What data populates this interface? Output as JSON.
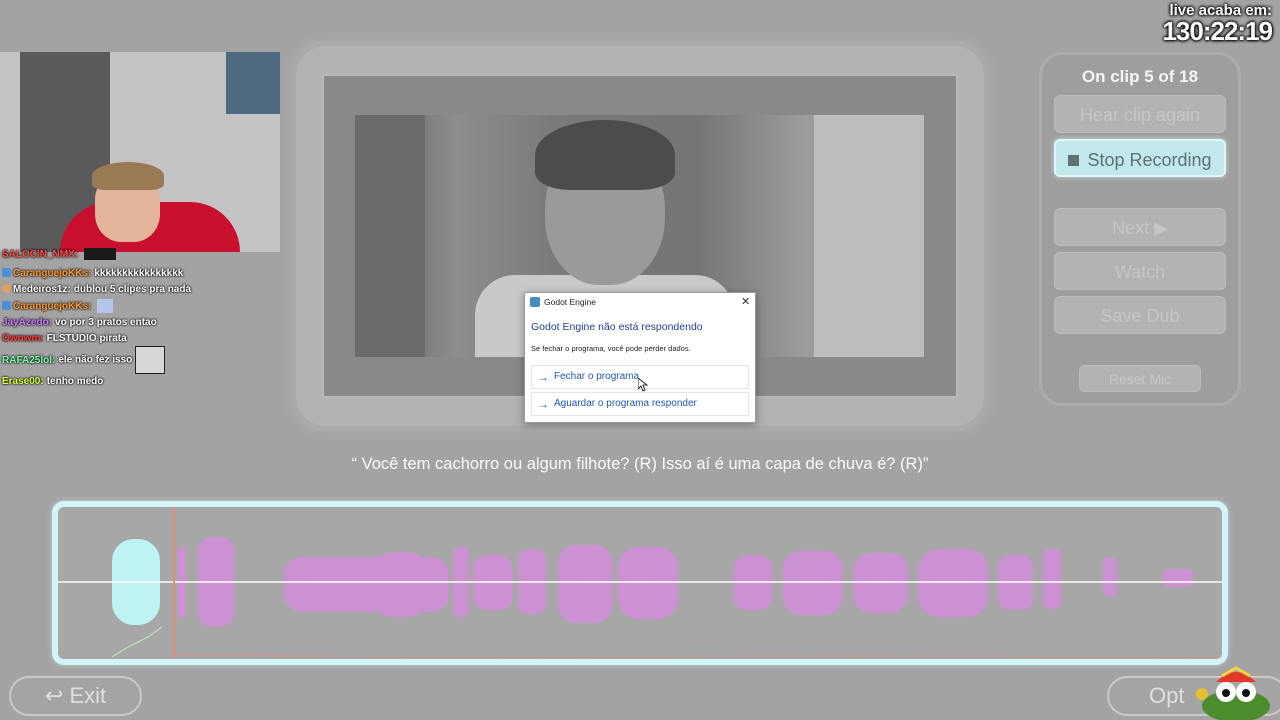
{
  "stream": {
    "live_label": "live acaba em:",
    "timer": "130:22:19"
  },
  "chat": [
    {
      "user": "SALOCIN_NMX:",
      "text": "",
      "user_color": "#ff4d4d"
    },
    {
      "user": "CaranguejoKKs:",
      "text": "kkkkkkkkkkkkkkkk",
      "user_color": "#ff9a2e"
    },
    {
      "user": "Medeiros1z:",
      "text": "dublou 5 clipes pra nada",
      "user_color": "#ffffff"
    },
    {
      "user": "CaranguejoKKs:",
      "text": "",
      "user_color": "#ff9a2e"
    },
    {
      "user": "JayAzedo:",
      "text": "vo por 3 pratos entao",
      "user_color": "#c77dff"
    },
    {
      "user": "Ownwm:",
      "text": "FLSTUDIO pirata",
      "user_color": "#ff3b3b"
    },
    {
      "user": "RAFA25lol:",
      "text": "ele não fez isso",
      "user_color": "#7dffb0"
    },
    {
      "user": "Erase00:",
      "text": "tenho medo",
      "user_color": "#d7ff3b"
    }
  ],
  "panel": {
    "clip_counter": "On clip 5 of 18",
    "hear_again": "Hear clip again",
    "stop_recording": "Stop Recording",
    "next": "Next ▶",
    "watch": "Watch",
    "save_dub": "Save Dub",
    "reset_mic": "Reset Mic"
  },
  "subtitle": "“ Você tem cachorro ou algum filhote? (R)  Isso aí é uma capa de chuva é? (R)”",
  "bottom": {
    "exit": "Exit",
    "options": "Opt"
  },
  "dialog": {
    "title": "Godot Engine",
    "heading": "Godot Engine não está respondendo",
    "message": "Se fechar o programa, você pode perder dados.",
    "option_close": "Fechar o programa",
    "option_wait": "Aguardar o programa responder"
  },
  "colors": {
    "background": "#a3a3a3",
    "accent_cyan": "#d3f5f8",
    "waveform": "#d08fd8",
    "waveform_recorded": "#bff3f2",
    "playhead": "#e88b7a"
  },
  "icons": {
    "exit": "return-arrow-icon",
    "stop": "stop-square-icon",
    "dialog_option": "arrow-right-icon"
  }
}
